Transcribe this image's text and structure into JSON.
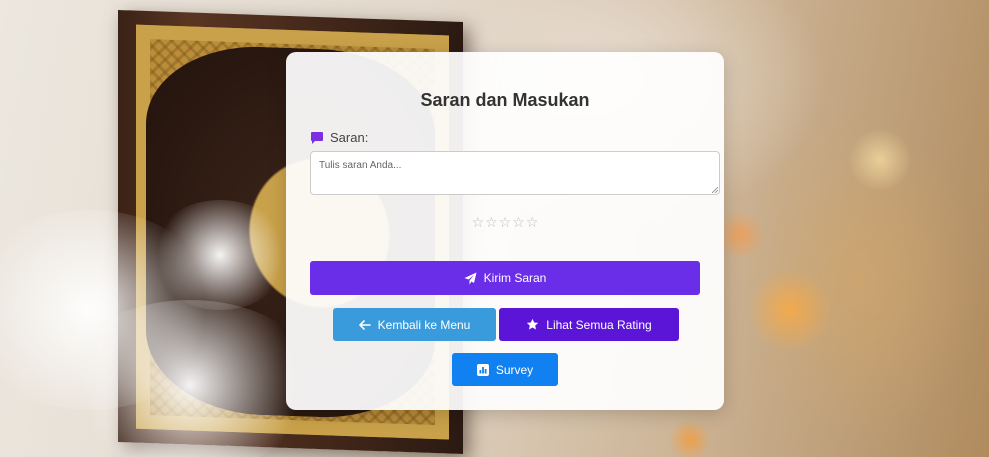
{
  "form": {
    "title": "Saran dan Masukan",
    "saran_label": "Saran:",
    "saran_placeholder": "Tulis saran Anda...",
    "saran_value": "",
    "rating": {
      "max_stars": 5,
      "selected": 0,
      "star_glyph": "☆"
    }
  },
  "buttons": {
    "submit": {
      "label": "Kirim Saran",
      "icon": "paper-plane-icon",
      "color": "#6b2ee8"
    },
    "back": {
      "label": "Kembali ke Menu",
      "icon": "arrow-left-icon",
      "color": "#3a9bdc"
    },
    "ratings": {
      "label": "Lihat Semua Rating",
      "icon": "star-icon",
      "color": "#5b15d6"
    },
    "survey": {
      "label": "Survey",
      "icon": "chart-icon",
      "color": "#1180f0"
    }
  },
  "colors": {
    "label_icon": "#7b2fe0",
    "star_empty": "#bdbdbd"
  }
}
